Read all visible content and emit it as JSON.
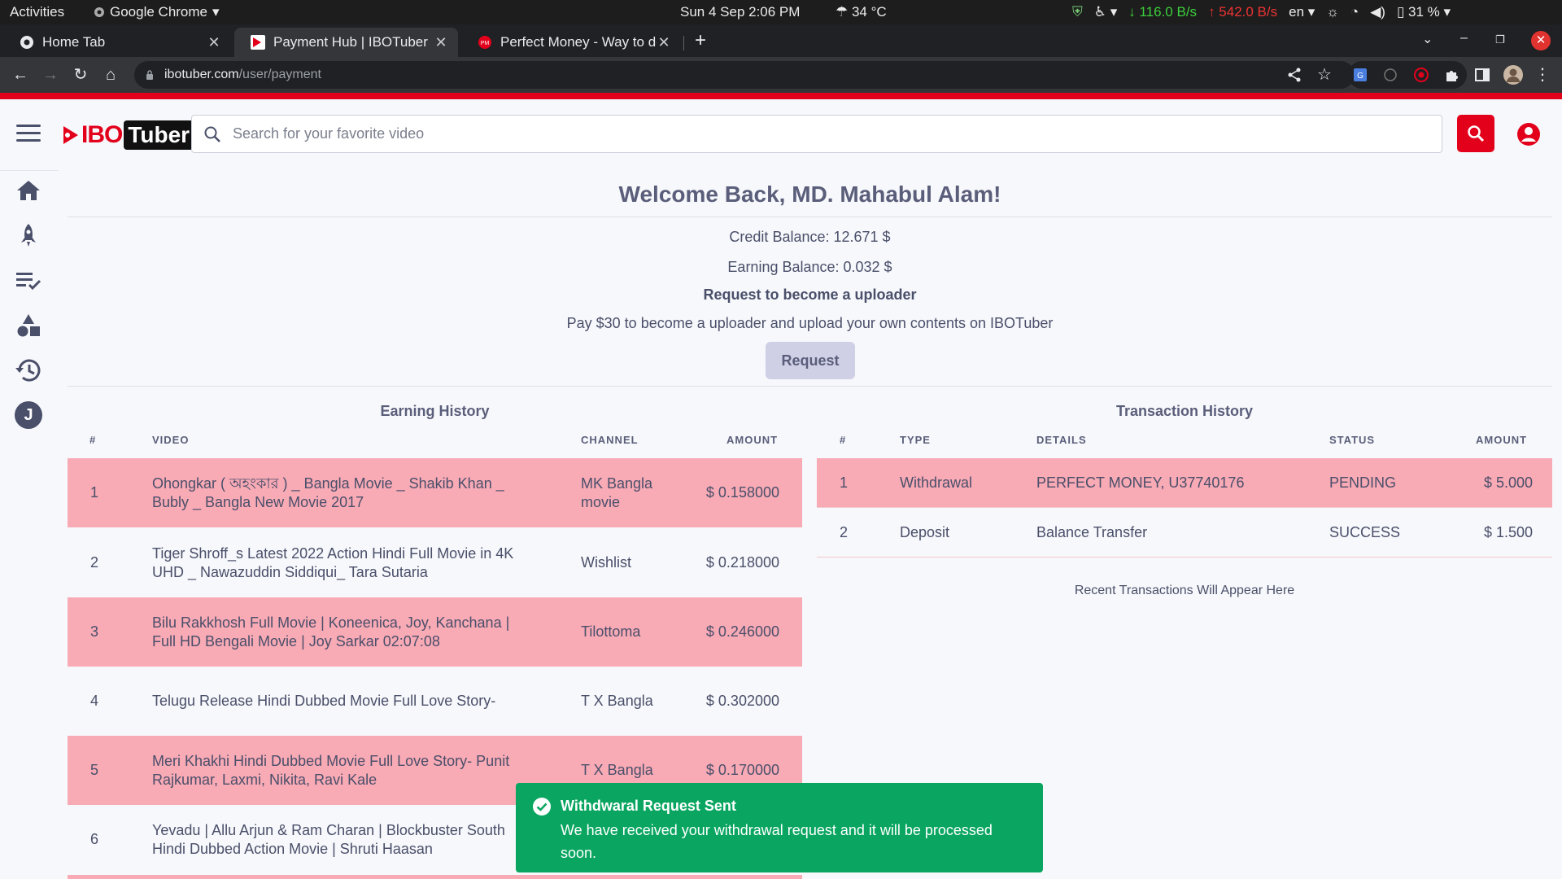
{
  "system_bar": {
    "activities": "Activities",
    "app_name": "Google Chrome",
    "clock": "Sun 4 Sep  2:06 PM",
    "weather": "34 °C",
    "net_down": "116.0  B/s",
    "net_up": "542.0  B/s",
    "lang": "en",
    "battery": "31 %"
  },
  "browser": {
    "tabs": [
      {
        "title": "Home Tab",
        "active": false
      },
      {
        "title": "Payment Hub | IBOTuber",
        "active": true
      },
      {
        "title": "Perfect Money - Way to do",
        "active": false
      }
    ],
    "url_host": "ibotuber.com",
    "url_path": "/user/payment"
  },
  "header": {
    "logo_ibo": "IBO",
    "logo_tuber": "Tuber",
    "search_placeholder": "Search for your favorite video"
  },
  "sidebar": {
    "items": [
      "home-icon",
      "rocket-icon",
      "playlist-check-icon",
      "shapes-icon",
      "history-icon",
      "avatar"
    ],
    "avatar_letter": "J"
  },
  "account": {
    "welcome": "Welcome Back, MD. Mahabul Alam!",
    "credit_balance": "Credit Balance: 12.671 $",
    "earning_balance": "Earning Balance: 0.032 $",
    "uploader_heading": "Request to become a uploader",
    "uploader_text": "Pay $30 to become a uploader and upload your own contents on IBOTuber",
    "request_label": "Request"
  },
  "earning_history": {
    "title": "Earning History",
    "columns": [
      "#",
      "VIDEO",
      "CHANNEL",
      "AMOUNT"
    ],
    "rows": [
      {
        "num": "1",
        "video": "Ohongkar ( অহংকার ) _ Bangla Movie _ Shakib Khan _ Bubly _ Bangla New Movie 2017",
        "channel": "MK Bangla movie",
        "amount": "$ 0.158000"
      },
      {
        "num": "2",
        "video": "Tiger Shroff_s Latest 2022 Action Hindi Full Movie in 4K UHD _ Nawazuddin Siddiqui_ Tara Sutaria",
        "channel": "Wishlist",
        "amount": "$ 0.218000"
      },
      {
        "num": "3",
        "video": "Bilu Rakkhosh Full Movie | Koneenica, Joy, Kanchana | Full HD Bengali Movie | Joy Sarkar 02:07:08",
        "channel": "Tilottoma",
        "amount": "$ 0.246000"
      },
      {
        "num": "4",
        "video": "Telugu Release Hindi Dubbed Movie Full Love Story-",
        "channel": "T X Bangla",
        "amount": "$ 0.302000"
      },
      {
        "num": "5",
        "video": "Meri Khakhi Hindi Dubbed Movie Full Love Story- Punit Rajkumar, Laxmi, Nikita, Ravi Kale",
        "channel": "T X Bangla",
        "amount": "$ 0.170000"
      },
      {
        "num": "6",
        "video": "Yevadu | Allu Arjun & Ram Charan | Blockbuster South Hindi Dubbed Action Movie | Shruti Haasan",
        "channel": "",
        "amount": ""
      }
    ]
  },
  "transaction_history": {
    "title": "Transaction History",
    "columns": [
      "#",
      "TYPE",
      "DETAILS",
      "STATUS",
      "AMOUNT"
    ],
    "rows": [
      {
        "num": "1",
        "type": "Withdrawal",
        "details": "PERFECT MONEY, U37740176",
        "status": "PENDING",
        "amount": "$ 5.000"
      },
      {
        "num": "2",
        "type": "Deposit",
        "details": "Balance Transfer",
        "status": "SUCCESS",
        "amount": "$ 1.500"
      }
    ],
    "footer": "Recent Transactions Will Appear Here"
  },
  "toast": {
    "title": "Withdwaral Request Sent",
    "message": "We have received your withdrawal request and it will be processed soon."
  },
  "colors": {
    "brand_red": "#e3001b",
    "row_pink": "#f8aab5",
    "toast_green": "#0aa661"
  }
}
